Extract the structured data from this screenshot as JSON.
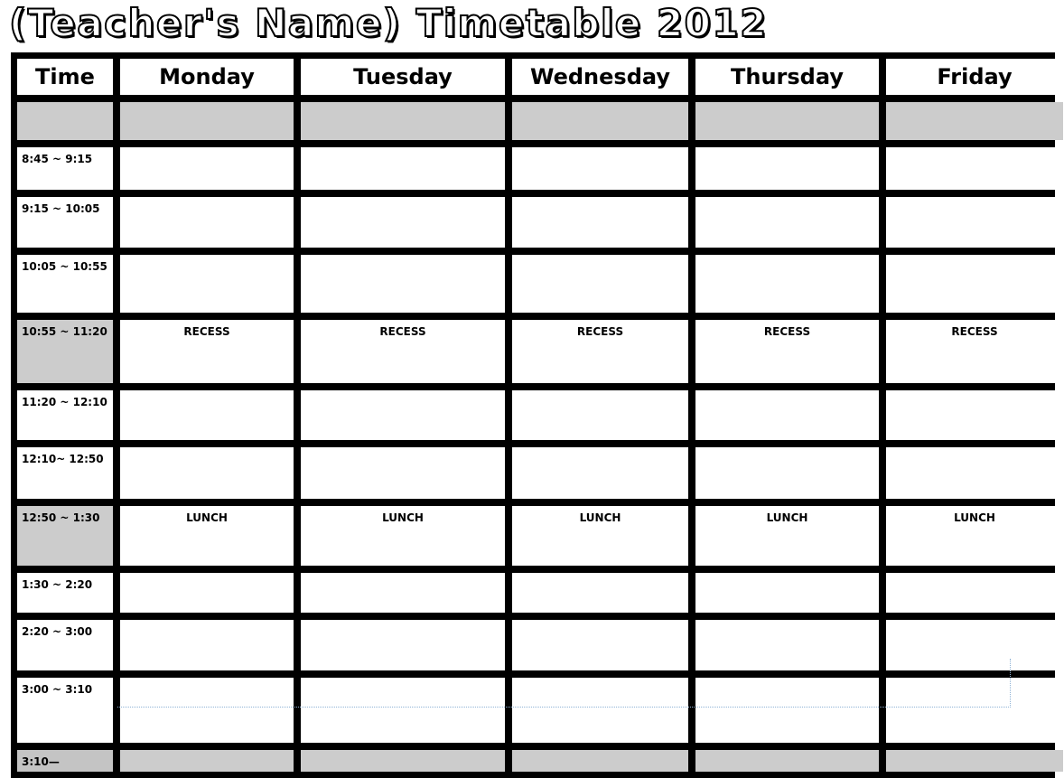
{
  "title": "(Teacher's Name) Timetable 2012",
  "header": {
    "time_label": "Time",
    "days": [
      "Monday",
      "Tuesday",
      "Wednesday",
      "Thursday",
      "Friday"
    ]
  },
  "rows": [
    {
      "time": "",
      "shaded": true,
      "note": ""
    },
    {
      "time": "8:45 ~ 9:15",
      "shaded": false,
      "note": ""
    },
    {
      "time": "9:15 ~ 10:05",
      "shaded": false,
      "note": ""
    },
    {
      "time": "10:05 ~ 10:55",
      "shaded": false,
      "note": ""
    },
    {
      "time": "10:55 ~ 11:20",
      "shaded": false,
      "time_shaded": true,
      "note": "RECESS"
    },
    {
      "time": "11:20 ~ 12:10",
      "shaded": false,
      "note": ""
    },
    {
      "time": "12:10~ 12:50",
      "shaded": false,
      "note": ""
    },
    {
      "time": "12:50 ~ 1:30",
      "shaded": false,
      "time_shaded": true,
      "note": "LUNCH"
    },
    {
      "time": "1:30 ~ 2:20",
      "shaded": false,
      "note": ""
    },
    {
      "time": "2:20 ~ 3:00",
      "shaded": false,
      "note": ""
    },
    {
      "time": "3:00 ~ 3:10",
      "shaded": false,
      "note": ""
    },
    {
      "time": "3:10—",
      "shaded": true,
      "note": ""
    }
  ],
  "colors": {
    "border": "#000000",
    "shade": "#cccccc",
    "background": "#ffffff"
  }
}
